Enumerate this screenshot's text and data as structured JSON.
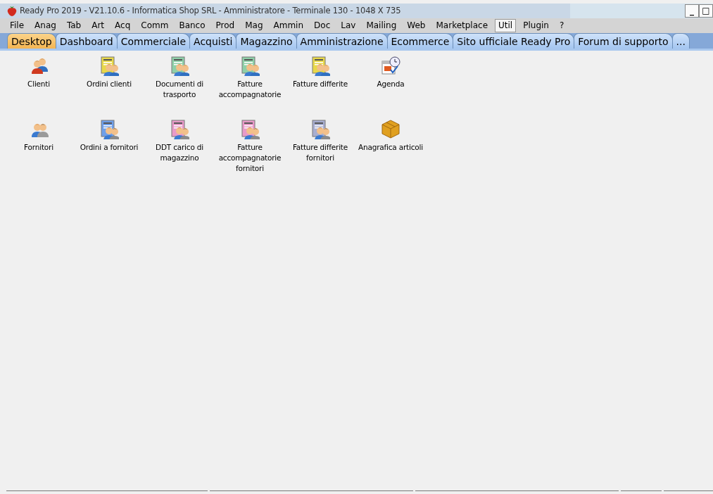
{
  "window": {
    "title": "Ready Pro 2019 - V21.10.6 - Informatica Shop SRL - Amministratore - Terminale 130 - 1048 X 735",
    "controls": [
      "_",
      "□"
    ]
  },
  "menu": [
    {
      "label": "File",
      "selected": false
    },
    {
      "label": "Anag",
      "selected": false
    },
    {
      "label": "Tab",
      "selected": false
    },
    {
      "label": "Art",
      "selected": false
    },
    {
      "label": "Acq",
      "selected": false
    },
    {
      "label": "Comm",
      "selected": false
    },
    {
      "label": "Banco",
      "selected": false
    },
    {
      "label": "Prod",
      "selected": false
    },
    {
      "label": "Mag",
      "selected": false
    },
    {
      "label": "Ammin",
      "selected": false
    },
    {
      "label": "Doc",
      "selected": false
    },
    {
      "label": "Lav",
      "selected": false
    },
    {
      "label": "Mailing",
      "selected": false
    },
    {
      "label": "Web",
      "selected": false
    },
    {
      "label": "Marketplace",
      "selected": false
    },
    {
      "label": "Util",
      "selected": true
    },
    {
      "label": "Plugin",
      "selected": false
    },
    {
      "label": "?",
      "selected": false
    }
  ],
  "tabs": [
    {
      "label": "Desktop",
      "selected": true
    },
    {
      "label": "Dashboard",
      "selected": false
    },
    {
      "label": "Commerciale",
      "selected": false
    },
    {
      "label": "Acquisti",
      "selected": false
    },
    {
      "label": "Magazzino",
      "selected": false
    },
    {
      "label": "Amministrazione",
      "selected": false
    },
    {
      "label": "Ecommerce",
      "selected": false
    },
    {
      "label": "Sito ufficiale Ready Pro",
      "selected": false
    },
    {
      "label": "Forum di supporto",
      "selected": false
    },
    {
      "label": "...",
      "selected": false
    }
  ],
  "desktop_rows": [
    [
      {
        "label": "Clienti",
        "kind": "people"
      },
      {
        "label": "Ordini clienti",
        "kind": "document",
        "color": "#e8d84a"
      },
      {
        "label": "Documenti di trasporto",
        "kind": "document",
        "color": "#8fd0a8"
      },
      {
        "label": "Fatture accompagnatorie",
        "kind": "document",
        "color": "#8fd0a8"
      },
      {
        "label": "Fatture differite",
        "kind": "document",
        "color": "#e8d84a"
      },
      {
        "label": "Agenda",
        "kind": "calendar"
      }
    ],
    [
      {
        "label": "Fornitori",
        "kind": "suppliers"
      },
      {
        "label": "Ordini a fornitori",
        "kind": "document",
        "color": "#6f9fe8"
      },
      {
        "label": "DDT carico di magazzino",
        "kind": "document",
        "color": "#e89ac8"
      },
      {
        "label": "Fatture accompagnatorie fornitori",
        "kind": "document",
        "color": "#e89ac8"
      },
      {
        "label": "Fatture differite fornitori",
        "kind": "document",
        "color": "#a8aed0"
      },
      {
        "label": "Anagrafica articoli",
        "kind": "box"
      }
    ]
  ]
}
